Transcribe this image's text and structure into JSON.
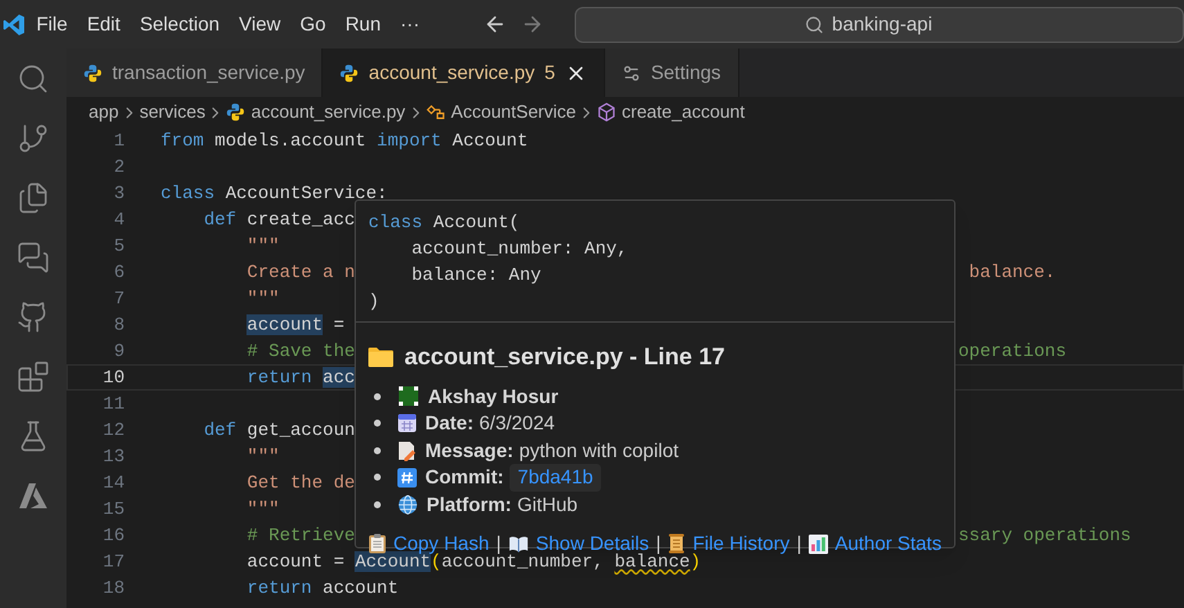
{
  "menu": [
    "File",
    "Edit",
    "Selection",
    "View",
    "Go",
    "Run",
    "···"
  ],
  "search": {
    "value": "banking-api"
  },
  "tabs": [
    {
      "label": "transaction_service.py",
      "kind": "python",
      "selected": false
    },
    {
      "label": "account_service.py",
      "kind": "python",
      "selected": true,
      "badge": "5"
    },
    {
      "label": "Settings",
      "kind": "settings",
      "selected": false
    }
  ],
  "breadcrumb": [
    {
      "label": "app",
      "kind": "folder"
    },
    {
      "label": "services",
      "kind": "folder"
    },
    {
      "label": "account_service.py",
      "kind": "python"
    },
    {
      "label": "AccountService",
      "kind": "class"
    },
    {
      "label": "create_account",
      "kind": "method"
    }
  ],
  "editor": {
    "lines": [
      {
        "number": "1",
        "current": false,
        "tokens": [
          {
            "kind": "keyword",
            "text": "from"
          },
          {
            "kind": "plain",
            "text": " models.account "
          },
          {
            "kind": "keyword",
            "text": "import"
          },
          {
            "kind": "plain",
            "text": " Account"
          }
        ]
      },
      {
        "number": "2",
        "current": false
      },
      {
        "number": "3",
        "current": false,
        "tokens": [
          {
            "kind": "keyword",
            "text": "class"
          },
          {
            "kind": "plain",
            "text": " AccountService:"
          }
        ]
      },
      {
        "number": "4",
        "current": false,
        "tokens": [
          {
            "kind": "keyword",
            "text": "    def"
          },
          {
            "kind": "plain",
            "text": " create_acc"
          }
        ]
      },
      {
        "number": "5",
        "current": false,
        "tokens": [
          {
            "kind": "string",
            "text": "        \"\"\""
          }
        ]
      },
      {
        "number": "6",
        "current": false,
        "tokens": [
          {
            "kind": "string",
            "text": "        Create a n"
          }
        ],
        "tail": [
          {
            "kind": "string",
            "text": " balance."
          }
        ]
      },
      {
        "number": "7",
        "current": false,
        "tokens": [
          {
            "kind": "string",
            "text": "        \"\"\""
          }
        ]
      },
      {
        "number": "8",
        "current": false,
        "tokens": [
          {
            "kind": "highlight",
            "text": "        account"
          },
          {
            "kind": "plain",
            "text": " ="
          }
        ]
      },
      {
        "number": "9",
        "current": false,
        "tokens": [
          {
            "kind": "comment",
            "text": "        # Save the"
          }
        ],
        "tail": [
          {
            "kind": "comment",
            "text": "operations"
          }
        ]
      },
      {
        "number": "10",
        "current": true,
        "tokens": [
          {
            "kind": "keyword",
            "text": "        return "
          },
          {
            "kind": "highlight",
            "text": "acc"
          }
        ]
      },
      {
        "number": "11",
        "current": false
      },
      {
        "number": "12",
        "current": false,
        "tokens": [
          {
            "kind": "keyword",
            "text": "    def"
          },
          {
            "kind": "plain",
            "text": " get_accoun"
          }
        ]
      },
      {
        "number": "13",
        "current": false,
        "tokens": [
          {
            "kind": "string",
            "text": "        \"\"\""
          }
        ]
      },
      {
        "number": "14",
        "current": false,
        "tokens": [
          {
            "kind": "string",
            "text": "        Get the de"
          }
        ]
      },
      {
        "number": "15",
        "current": false,
        "tokens": [
          {
            "kind": "string",
            "text": "        \"\"\""
          }
        ]
      },
      {
        "number": "16",
        "current": false,
        "tokens": [
          {
            "kind": "comment",
            "text": "        # Retrieve"
          }
        ],
        "tail": [
          {
            "kind": "comment",
            "text": "ssary operations"
          }
        ]
      },
      {
        "number": "17",
        "current": false,
        "tokens": [
          {
            "kind": "plain",
            "text": "        account = "
          },
          {
            "kind": "highlight",
            "text": "Account"
          },
          {
            "kind": "bracket",
            "text": "("
          },
          {
            "kind": "plain",
            "text": "account_number, "
          },
          {
            "kind": "warning",
            "text": "balance"
          },
          {
            "kind": "bracket",
            "text": ")"
          }
        ]
      },
      {
        "number": "18",
        "current": false,
        "tokens": [
          {
            "kind": "keyword",
            "text": "        return"
          },
          {
            "kind": "plain",
            "text": " account"
          }
        ]
      }
    ]
  },
  "hover": {
    "signature": [
      [
        {
          "kind": "keyword",
          "text": "class"
        },
        {
          "kind": "plain",
          "text": " Account("
        }
      ],
      [
        {
          "kind": "plain",
          "text": "    account_number: Any,"
        }
      ],
      [
        {
          "kind": "plain",
          "text": "    balance: Any"
        }
      ],
      [
        {
          "kind": "plain",
          "text": ")"
        }
      ]
    ],
    "title": "account_service.py - Line 17",
    "items": [
      {
        "kind": "author",
        "value": "Akshay Hosur"
      },
      {
        "kind": "date",
        "label": "Date:",
        "value": "6/3/2024"
      },
      {
        "kind": "message",
        "label": "Message:",
        "value": "python with copilot"
      },
      {
        "kind": "commit",
        "label": "Commit:",
        "value": "7bda41b"
      },
      {
        "kind": "platform",
        "label": "Platform:",
        "value": "GitHub"
      }
    ],
    "separator": "|",
    "links": [
      {
        "kind": "clipboard",
        "label": "Copy Hash"
      },
      {
        "kind": "book",
        "label": "Show Details"
      },
      {
        "kind": "scroll",
        "label": "File History"
      },
      {
        "kind": "chart",
        "label": "Author Stats"
      }
    ]
  }
}
